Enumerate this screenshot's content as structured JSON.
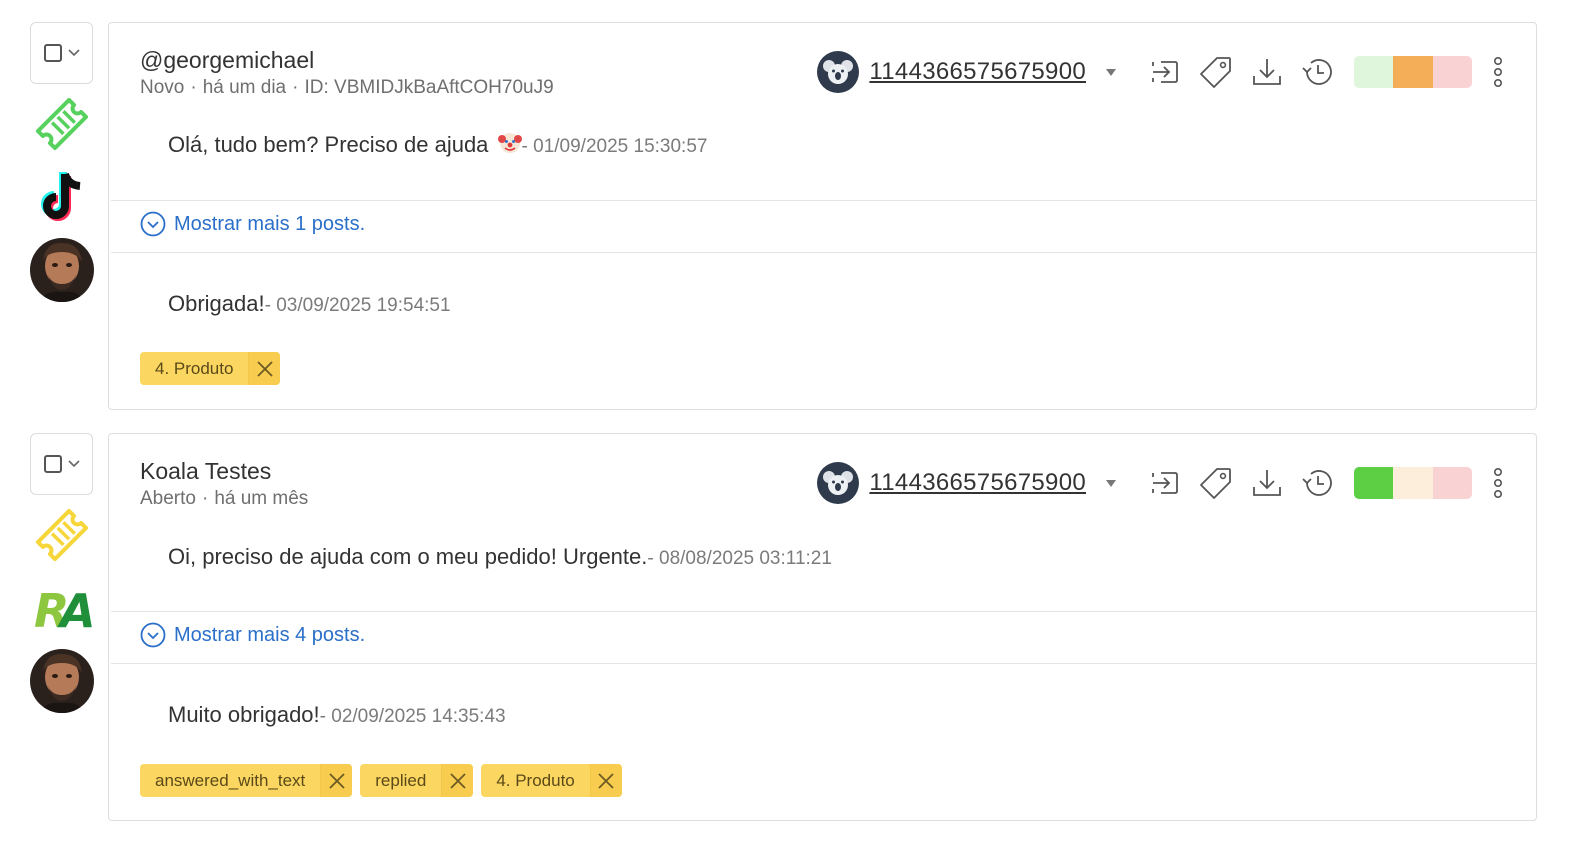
{
  "tickets": [
    {
      "author": "@georgemichael",
      "status": "Novo",
      "age": "há um dia",
      "id_text": "ID: VBMIDJkBaAftCOH70uJ9",
      "phone": "1144366575675900",
      "ticket_icon_color": "#57d15d",
      "channel": "tiktok-icon",
      "sentiment": [
        "#dff5dc",
        "#f4ae58",
        "#f9d3d3"
      ],
      "first_message": {
        "text": "Olá, tudo bem? Preciso de ajuda ",
        "emoji": "clown-face-icon",
        "timestamp": "- 01/09/2025 15:30:57"
      },
      "show_more": "Mostrar mais 1 posts.",
      "last_message": {
        "text": "Obrigada!",
        "timestamp": "- 03/09/2025 19:54:51"
      },
      "tags": [
        "4. Produto"
      ]
    },
    {
      "author": "Koala Testes",
      "status": "Aberto",
      "age": "há um mês",
      "id_text": "",
      "phone": "1144366575675900",
      "ticket_icon_color": "#f7d63a",
      "channel": "reclame-aqui-icon",
      "channel_text": "RA",
      "sentiment": [
        "#5ccf45",
        "#fdeedb",
        "#f9d3d3"
      ],
      "first_message": {
        "text": "Oi, preciso de ajuda com o meu pedido! Urgente.",
        "timestamp": "- 08/08/2025 03:11:21"
      },
      "show_more": "Mostrar mais 4 posts.",
      "last_message": {
        "text": "Muito obrigado!",
        "timestamp": "- 02/09/2025 14:35:43"
      },
      "tags": [
        "answered_with_text",
        "replied",
        "4. Produto"
      ]
    }
  ]
}
